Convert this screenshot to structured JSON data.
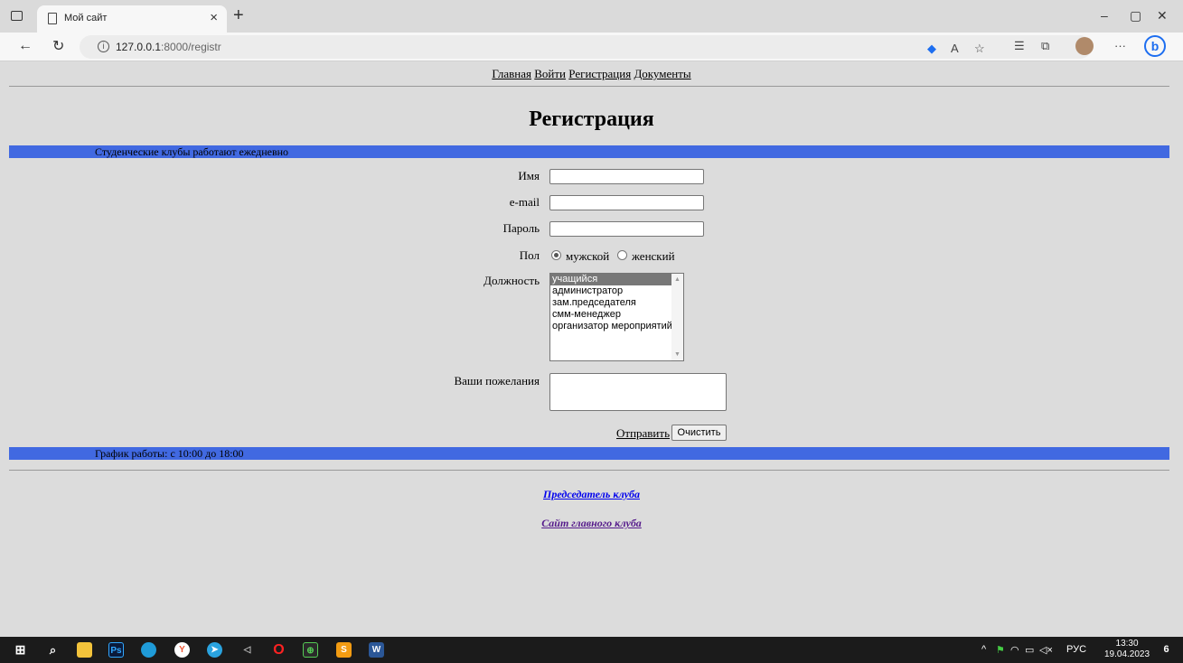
{
  "browser": {
    "tab_title": "Мой сайт",
    "url_host": "127.0.0.1",
    "url_rest": ":8000/registr"
  },
  "nav": {
    "links": [
      "Главная",
      "Войти",
      "Регистрация",
      "Документы"
    ]
  },
  "page_title": "Регистрация",
  "top_banner": "Студенческие клубы работают ежедневно",
  "form": {
    "name_label": "Имя",
    "email_label": "e-mail",
    "password_label": "Пароль",
    "gender_label": "Пол",
    "gender_options": [
      "мужской",
      "женский"
    ],
    "gender_selected": "мужской",
    "position_label": "Должность",
    "position_options": [
      "учащийся",
      "администратор",
      "зам.председателя",
      "смм-менеджер",
      "организатор мероприятий"
    ],
    "position_selected": "учащийся",
    "wishes_label": "Ваши пожелания",
    "submit_label": "Отправить",
    "clear_label": "Очистить"
  },
  "bottom_banner": "График работы: с 10:00 до 18:00",
  "footer_links": [
    "Председатель клуба",
    "Сайт главного клуба"
  ],
  "colors": {
    "page_bg": "#dcdcdc",
    "banner_bg": "#4169e1",
    "link_unvisited": "#0000ee",
    "link_visited": "#551a8b"
  },
  "taskbar": {
    "lang": "РУС",
    "time": "13:30",
    "date": "19.04.2023",
    "notifications": "6",
    "apps": [
      "start-icon",
      "search-icon",
      "file-explorer-icon",
      "photoshop-icon",
      "edge-icon",
      "yandex-browser-icon",
      "telegram-icon",
      "visual-studio-icon",
      "opera-icon",
      "app-icon",
      "sublime-text-icon",
      "word-icon"
    ]
  }
}
